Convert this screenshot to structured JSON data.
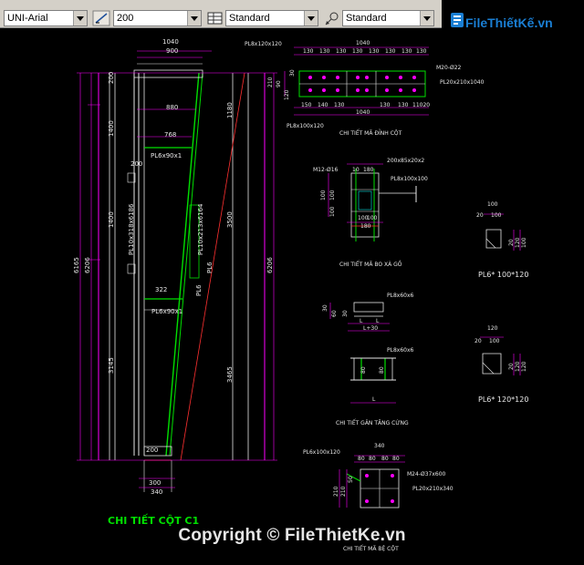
{
  "toolbar": {
    "font_combo": "UNI-Arial",
    "height_combo": "200",
    "dimstyle_combo": "Standard",
    "tablestyle_combo": "Standard",
    "icons": [
      "text-style-icon",
      "dim-style-icon",
      "table-style-icon",
      "multileader-style-icon"
    ]
  },
  "logo": {
    "text": "FileThiếtKế.vn"
  },
  "drawing": {
    "column_title": "CHI TIẾT CỘT C1",
    "ma_dinh_cot_title": "CHI TIẾT MÃ ĐỈNH CỘT",
    "ma_bo_xa_go_title": "CHI TIẾT MÃ BO XÀ GỒ",
    "gan_tang_cung_title": "CHI TIẾT GÂN TĂNG CỨNG",
    "ma_be_cot_title": "CHI TIẾT MÃ BỆ CỘT",
    "pl6_100_label": "PL6* 100*120",
    "pl6_120_label": "PL6* 120*120",
    "col_top_dims": [
      "1040",
      "900",
      "880",
      "768"
    ],
    "col_side_dims": [
      "200",
      "1400",
      "1400",
      "3145",
      "6206",
      "6165",
      "6206",
      "1180",
      "3500",
      "3465"
    ],
    "col_labels": [
      "PL6x90x1",
      "PL10x318x6186",
      "PL10x213x6164",
      "PL6",
      "PL6",
      "PL6x90x1",
      "322",
      "200",
      "200"
    ],
    "col_bottom_dims": [
      "200",
      "300",
      "340",
      "20"
    ],
    "dinh_cot_top_dims": [
      "1040",
      "130",
      "130",
      "130",
      "130",
      "130",
      "130",
      "130",
      "130"
    ],
    "dinh_cot_bottom_dims": [
      "150",
      "140",
      "130",
      "130",
      "130",
      "11020",
      "1040"
    ],
    "dinh_cot_labels": [
      "PL8x120x120",
      "M20-Ø22",
      "PL20x210x1040",
      "PL8x100x120",
      "210",
      "90",
      "120",
      "30"
    ],
    "xa_go_labels": [
      "M12-Ø16",
      "200x85x20x2",
      "PL8x100x100",
      "10",
      "180",
      "180",
      "100",
      "100",
      "100",
      "100",
      "100"
    ],
    "pl6_100_dims": [
      "100",
      "20",
      "100",
      "20",
      "120",
      "100"
    ],
    "pl6_120_dims": [
      "120",
      "20",
      "100",
      "20",
      "120",
      "120"
    ],
    "gan_labels": [
      "PL8x60x6",
      "PL8x60x6",
      "L",
      "L",
      "L+30",
      "30",
      "60",
      "30",
      "80",
      "80",
      "L"
    ],
    "be_cot_labels": [
      "PL6x100x120",
      "340",
      "80",
      "80",
      "80",
      "80",
      "M24-Ø37x600",
      "PL20x210x340",
      "210",
      "210",
      "50"
    ]
  },
  "watermark": {
    "text": "Copyright © FileThietKe.vn"
  },
  "colors": {
    "background": "#000000",
    "cad_green": "#00e000",
    "cad_magenta": "#ff00ff",
    "cad_white": "#e8e8e8",
    "cad_cyan": "#00e0e0",
    "cad_red": "#ff3030",
    "logo_blue": "#1a7fd4",
    "logo_green": "#2ea02e",
    "toolbar_gray": "#d4d0c8"
  }
}
